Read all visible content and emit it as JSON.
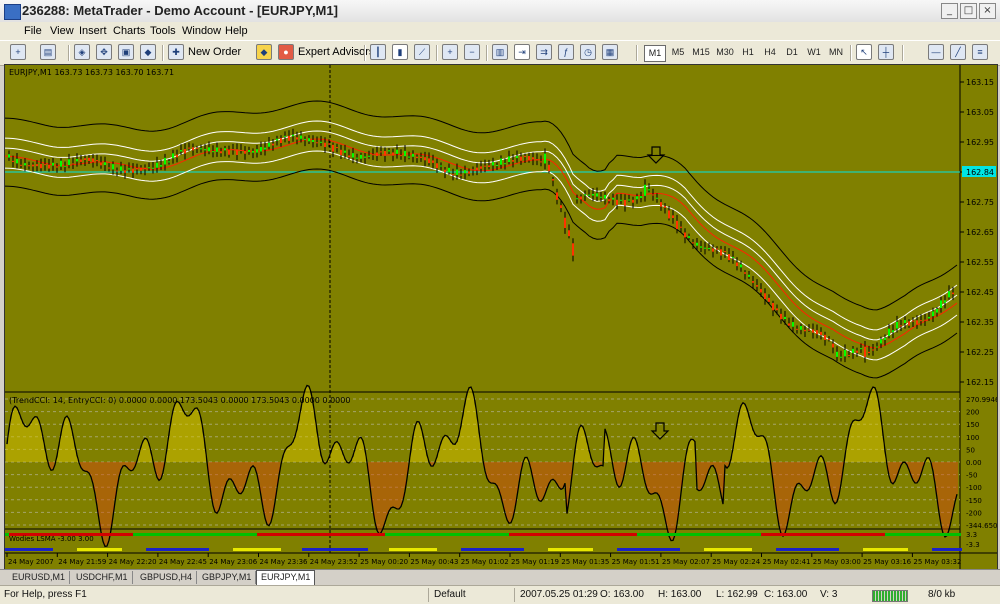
{
  "window": {
    "title": "236288: MetaTrader - Demo Account - [EURJPY,M1]",
    "minimize": "_",
    "maximize": "□",
    "close": "×"
  },
  "menu": [
    "File",
    "View",
    "Insert",
    "Charts",
    "Tools",
    "Window",
    "Help"
  ],
  "toolbar": {
    "new_order": "New Order",
    "expert_advisors": "Expert Advisors",
    "timeframes": [
      "M1",
      "M5",
      "M15",
      "M30",
      "H1",
      "H4",
      "D1",
      "W1",
      "MN"
    ],
    "active_timeframe": "M1"
  },
  "chart": {
    "symbol_info": "EURJPY,M1  163.73 163.73 163.70 163.71",
    "price_labels": [
      "163.15",
      "163.05",
      "162.95",
      "162.84",
      "162.75",
      "162.65",
      "162.55",
      "162.45",
      "162.35",
      "162.25",
      "162.15"
    ],
    "current_price": "162.84",
    "indicator1_info": "(TrendCCI: 14, EntryCCI: 0)  0.0000 0.0000 173.5043 0.0000 173.5043 0.0000 0.0000",
    "indicator1_labels": [
      "270.9946",
      "200",
      "150",
      "100",
      "50",
      "0.00",
      "-50",
      "-100",
      "-150",
      "-200",
      "-344.650"
    ],
    "indicator2_info": "Wodies LSMA -3.00 3.00",
    "indicator2_labels": [
      "3.3",
      "-3.3"
    ],
    "time_labels": [
      "24 May 2007",
      "24 May 21:59",
      "24 May 22:20",
      "24 May 22:45",
      "24 May 23:06",
      "24 May 23:36",
      "24 May 23:52",
      "25 May 00:20",
      "25 May 00:43",
      "25 May 01:02",
      "25 May 01:19",
      "25 May 01:35",
      "25 May 01:51",
      "25 May 02:07",
      "25 May 02:24",
      "25 May 02:41",
      "25 May 03:00",
      "25 May 03:16",
      "25 May 03:32"
    ],
    "colors": {
      "background": "#808000",
      "grid": "#a5a56a",
      "bull": "#00ff00",
      "bear": "#ff3300",
      "band": "#ffffff",
      "mid": "#ff2200",
      "outer": "#000000",
      "current": "#00e5e5"
    }
  },
  "tabs": [
    "EURUSD,M1",
    "USDCHF,M1",
    "GBPUSD,H4",
    "GBPJPY,M1",
    "EURJPY,M1"
  ],
  "active_tab": "EURJPY,M1",
  "status": {
    "help": "For Help, press F1",
    "profile": "Default",
    "datetime": "2007.05.25 01:29",
    "open": "O: 163.00",
    "high": "H: 163.00",
    "low": "L: 162.99",
    "close": "C: 163.00",
    "volume": "V: 3",
    "traffic": "8/0 kb"
  }
}
